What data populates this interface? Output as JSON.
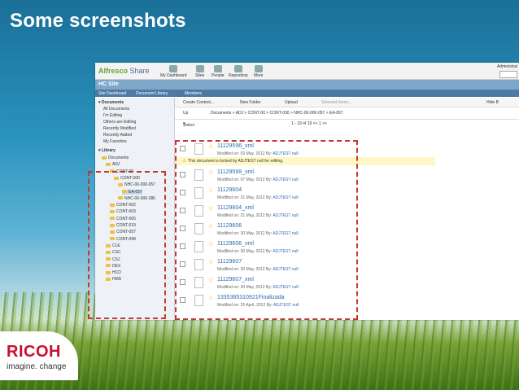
{
  "slide": {
    "title": "Some screenshots",
    "logo_brand": "RICOH",
    "logo_tagline": "imagine. change"
  },
  "app": {
    "name_part1": "Alfresco",
    "name_part2": "Share",
    "nav": [
      "My Dashboard",
      "Sites",
      "People",
      "Repository",
      "More"
    ],
    "admin_label": "Administrat",
    "site_title": "HC Site",
    "tabs": [
      "Site Dashboard",
      "Document Library",
      "Members"
    ]
  },
  "left_panel": {
    "documents_header": "Documents",
    "doc_items": [
      "All Documents",
      "I'm Editing",
      "Others are Editing",
      "Recently Modified",
      "Recently Added",
      "My Favorites"
    ],
    "library_header": "Library",
    "tree": [
      {
        "label": "Documents",
        "level": 0
      },
      {
        "label": "ADJ",
        "level": 1
      },
      {
        "label": "CONT-00",
        "level": 2
      },
      {
        "label": "CONT-000",
        "level": 3
      },
      {
        "label": "NHC-00-000-057",
        "level": 4
      },
      {
        "label": "EA-057",
        "level": 5,
        "selected": true
      },
      {
        "label": "NHC-00-000-286",
        "level": 4
      },
      {
        "label": "CONT-002",
        "level": 2
      },
      {
        "label": "CONT-003",
        "level": 2
      },
      {
        "label": "CONT-005",
        "level": 2
      },
      {
        "label": "CONT-019",
        "level": 2
      },
      {
        "label": "CONT-057",
        "level": 2
      },
      {
        "label": "CONT-068",
        "level": 2
      },
      {
        "label": "CLE",
        "level": 1
      },
      {
        "label": "CSC",
        "level": 1
      },
      {
        "label": "CSJ",
        "level": 1
      },
      {
        "label": "DEX",
        "level": 1
      },
      {
        "label": "HCD",
        "level": 1
      },
      {
        "label": "HMS",
        "level": 1
      }
    ]
  },
  "toolbar": {
    "create_content": "Create Content...",
    "new_folder": "New Folder",
    "upload": "Upload",
    "selected_items": "Selected Items...",
    "hide": "Hide B"
  },
  "breadcrumb": {
    "up": "Up",
    "path": "Documents  >  ADJ  >  CONT-00  >  CONT-000  >  NHC-00-000-057  >  EA-057"
  },
  "pager": {
    "select": "Select",
    "info": "1 - 19 of 19   <<   1   >>"
  },
  "files": [
    {
      "name": "11129596_xml",
      "date": "03 May, 2012",
      "by": "ADJTEST null"
    },
    {
      "name": "11129599_xml",
      "date": "07 May, 2012",
      "by": "ADJTEST null"
    },
    {
      "name": "11129604",
      "date": "21 May, 2012",
      "by": "ADJTEST null"
    },
    {
      "name": "11129604_xml",
      "date": "21 May, 2012",
      "by": "ADJTEST null"
    },
    {
      "name": "11129606",
      "date": "30 May, 2012",
      "by": "ADJTEST null"
    },
    {
      "name": "11129606_xml",
      "date": "30 May, 2012",
      "by": "ADJTEST null"
    },
    {
      "name": "11129607",
      "date": "30 May, 2012",
      "by": "ADJTEST null"
    },
    {
      "name": "11129607_xml",
      "date": "30 May, 2012",
      "by": "ADJTEST null"
    },
    {
      "name": "1335365310921Finalizada",
      "date": "25 April, 2012",
      "by": "ADJTEST null"
    }
  ],
  "lock_message": "This document is locked by ADJTEST null for editing.",
  "modified_on_label": "Modified on:",
  "by_label": "By:",
  "colors": {
    "accent_red": "#c0392b",
    "ricoh_red": "#c8102e",
    "link_blue": "#2a6ab0"
  }
}
